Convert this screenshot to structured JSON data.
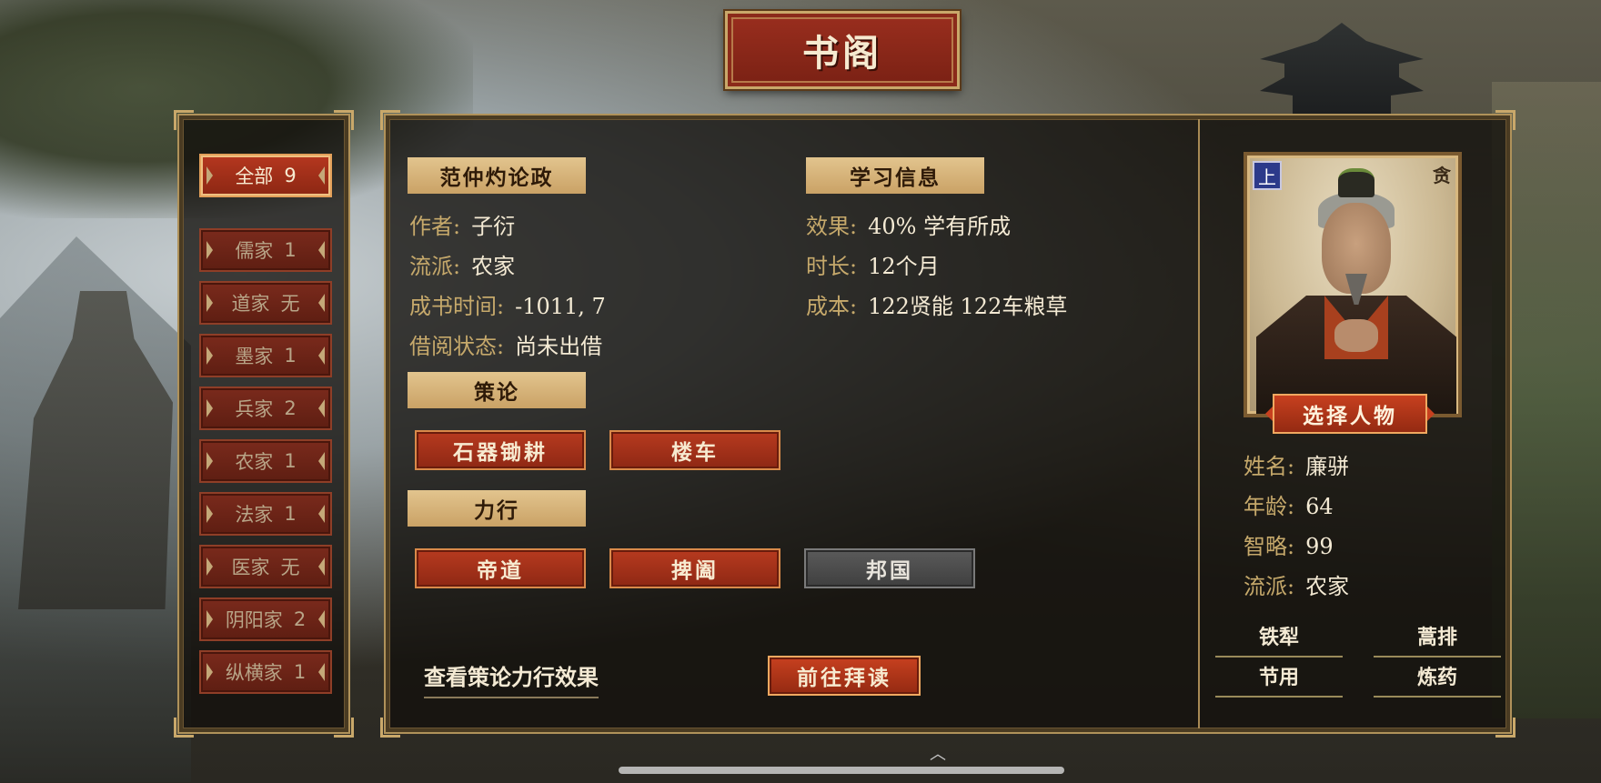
{
  "title": "书阁",
  "schools": [
    {
      "name": "全部",
      "count": "9",
      "active": true
    },
    {
      "name": "儒家",
      "count": "1"
    },
    {
      "name": "道家",
      "count": "无"
    },
    {
      "name": "墨家",
      "count": "1"
    },
    {
      "name": "兵家",
      "count": "2"
    },
    {
      "name": "农家",
      "count": "1"
    },
    {
      "name": "法家",
      "count": "1"
    },
    {
      "name": "医家",
      "count": "无"
    },
    {
      "name": "阴阳家",
      "count": "2"
    },
    {
      "name": "纵横家",
      "count": "1"
    }
  ],
  "book": {
    "title": "范仲灼论政",
    "author_label": "作者:",
    "author": "子衍",
    "school_label": "流派:",
    "school": "农家",
    "written_label": "成书时间:",
    "written": "-1011, 7",
    "status_label": "借阅状态:",
    "status": "尚未出借"
  },
  "study": {
    "header": "学习信息",
    "effect_label": "效果:",
    "effect": "40%  学有所成",
    "duration_label": "时长:",
    "duration": "12个月",
    "cost_label": "成本:",
    "cost": "122贤能  122车粮草"
  },
  "strategy": {
    "header": "策论",
    "items": [
      "石器锄耕",
      "楼车"
    ]
  },
  "practice": {
    "header": "力行",
    "items": [
      "帝道",
      "捭阖",
      "邦国"
    ]
  },
  "actions": {
    "view_effects": "查看策论力行效果",
    "go_read": "前往拜读"
  },
  "character": {
    "rank_badge": "上",
    "trait_mark": "贪",
    "select_label": "选择人物",
    "name_label": "姓名:",
    "name": "廉骈",
    "age_label": "年龄:",
    "age": "64",
    "wisdom_label": "智略:",
    "wisdom": "99",
    "school_label": "流派:",
    "school": "农家",
    "traits": [
      "铁犁",
      "蒿排",
      "节用",
      "炼药"
    ]
  },
  "colors": {
    "accent_red": "#b73a1f",
    "gold": "#c9a86a",
    "header_tan": "#e2c48e"
  }
}
